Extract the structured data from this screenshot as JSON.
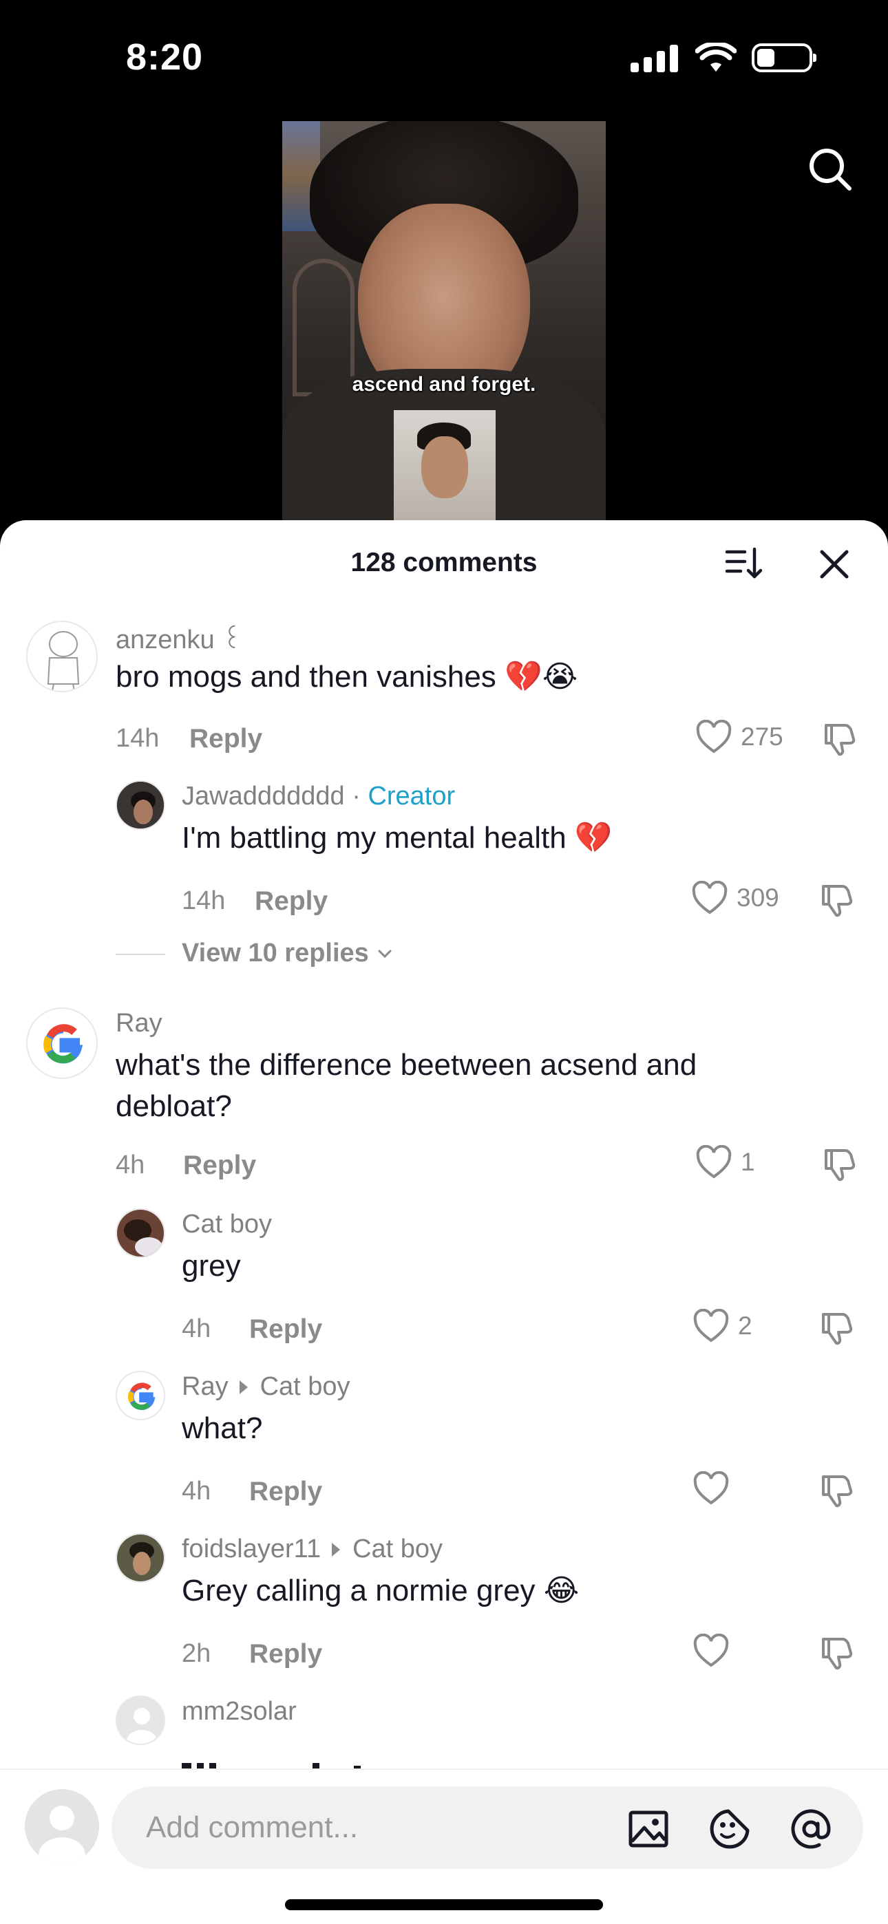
{
  "status_bar": {
    "time": "8:20",
    "battery_level": 0.35
  },
  "video": {
    "caption": "ascend and forget."
  },
  "sheet": {
    "title": "128 comments"
  },
  "comments": [
    {
      "username": "anzenku ꒰",
      "text": "bro mogs and then vanishes 💔😭",
      "age": "14h",
      "reply": "Reply",
      "likes": "275"
    },
    {
      "username": "Jawaddddddd",
      "separator": " · ",
      "badge": "Creator",
      "text": "I'm battling my mental health 💔",
      "age": "14h",
      "reply": "Reply",
      "likes": "309"
    },
    {
      "username": "Ray",
      "text": "what's the difference beetween acsend and debloat?",
      "age": "4h",
      "reply": "Reply",
      "likes": "1"
    },
    {
      "username": "Cat boy",
      "text": "grey",
      "age": "4h",
      "reply": "Reply",
      "likes": "2"
    },
    {
      "username": "Ray",
      "reply_to": "Cat boy",
      "text": "what?",
      "age": "4h",
      "reply": "Reply",
      "likes": ""
    },
    {
      "username": "foidslayer11",
      "reply_to": "Cat boy",
      "text": "Grey calling a normie grey 😂",
      "age": "2h",
      "reply": "Reply",
      "likes": ""
    },
    {
      "username": "mm2solar"
    }
  ],
  "view_replies": "View 10 replies",
  "composer": {
    "placeholder": "Add comment..."
  },
  "colors": {
    "creator": "#1da1c9",
    "muted": "#8a8a8a",
    "text": "#161823"
  }
}
